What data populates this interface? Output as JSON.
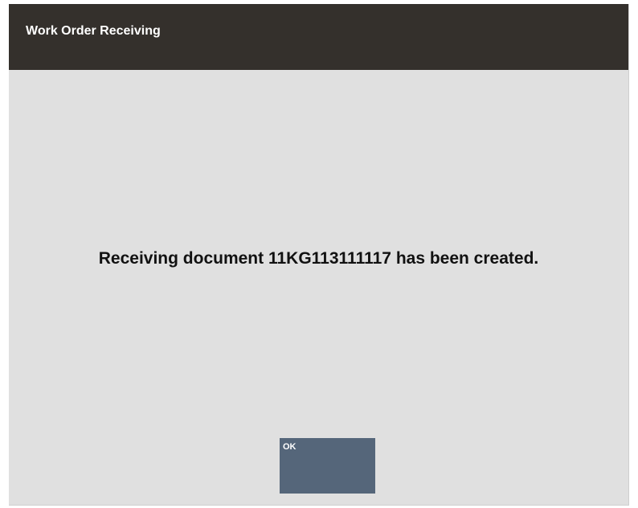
{
  "window": {
    "title": "Work Order Receiving"
  },
  "dialog": {
    "message": "Receiving document 11KG113111117 has been created.",
    "ok_label": "OK"
  },
  "colors": {
    "title_bar": "#34302c",
    "background": "#e0e0e0",
    "button": "#55667a"
  }
}
